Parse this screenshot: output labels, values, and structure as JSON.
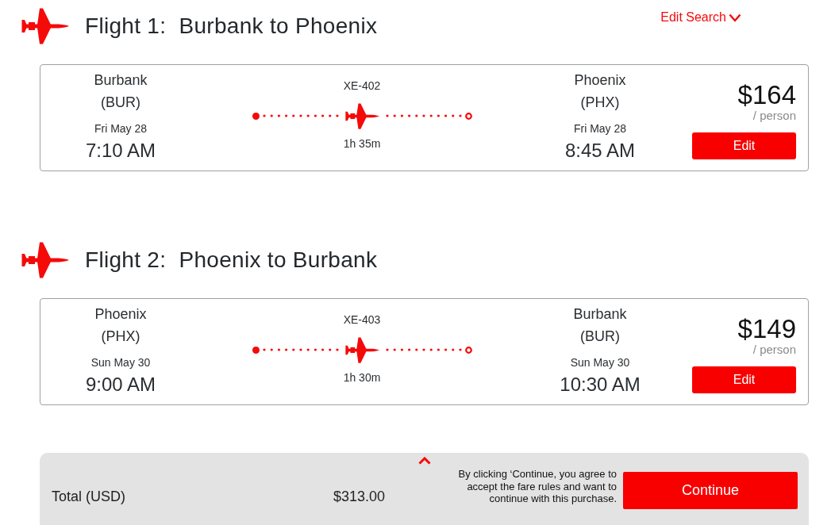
{
  "edit_search": {
    "label": "Edit Search"
  },
  "flights": [
    {
      "title": "Flight 1:  Burbank to Phoenix",
      "departure": {
        "city": "Burbank",
        "code": "(BUR)",
        "date": "Fri May 28",
        "time": "7:10 AM"
      },
      "flight_number": "XE-402",
      "duration": "1h 35m",
      "arrival": {
        "city": "Phoenix",
        "code": "(PHX)",
        "date": "Fri May 28",
        "time": "8:45 AM"
      },
      "price": "$164",
      "price_unit": "/ person",
      "edit_button": "Edit"
    },
    {
      "title": "Flight 2:  Phoenix to Burbank",
      "departure": {
        "city": "Phoenix",
        "code": "(PHX)",
        "date": "Sun May 30",
        "time": "9:00 AM"
      },
      "flight_number": "XE-403",
      "duration": "1h 30m",
      "arrival": {
        "city": "Burbank",
        "code": "(BUR)",
        "date": "Sun May 30",
        "time": "10:30 AM"
      },
      "price": "$149",
      "price_unit": "/ person",
      "edit_button": "Edit"
    }
  ],
  "summary_bar": {
    "total_label": "Total (USD)",
    "total": "$313.00",
    "disclaimer": "By clicking ‘Continue, you agree to accept the fare rules and want to continue with this purchase.",
    "continue_button": "Continue"
  }
}
